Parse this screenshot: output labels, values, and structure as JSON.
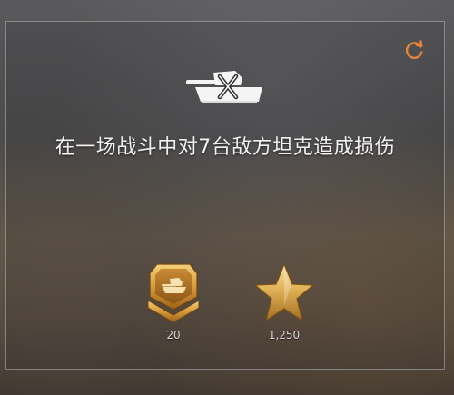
{
  "achievement": {
    "title": "在一场战斗中对7台敌方坦克造成损伤"
  },
  "icons": {
    "refresh": "refresh-icon",
    "hero": "tank-crossed-icon",
    "medal": "medal-badge-icon",
    "star": "star-icon"
  },
  "rewards": [
    {
      "name": "medal",
      "value": "20"
    },
    {
      "name": "star",
      "value": "1,250"
    }
  ],
  "colors": {
    "accent": "#e8833a",
    "gold": "#d9a441",
    "text": "#f2f2f2"
  }
}
